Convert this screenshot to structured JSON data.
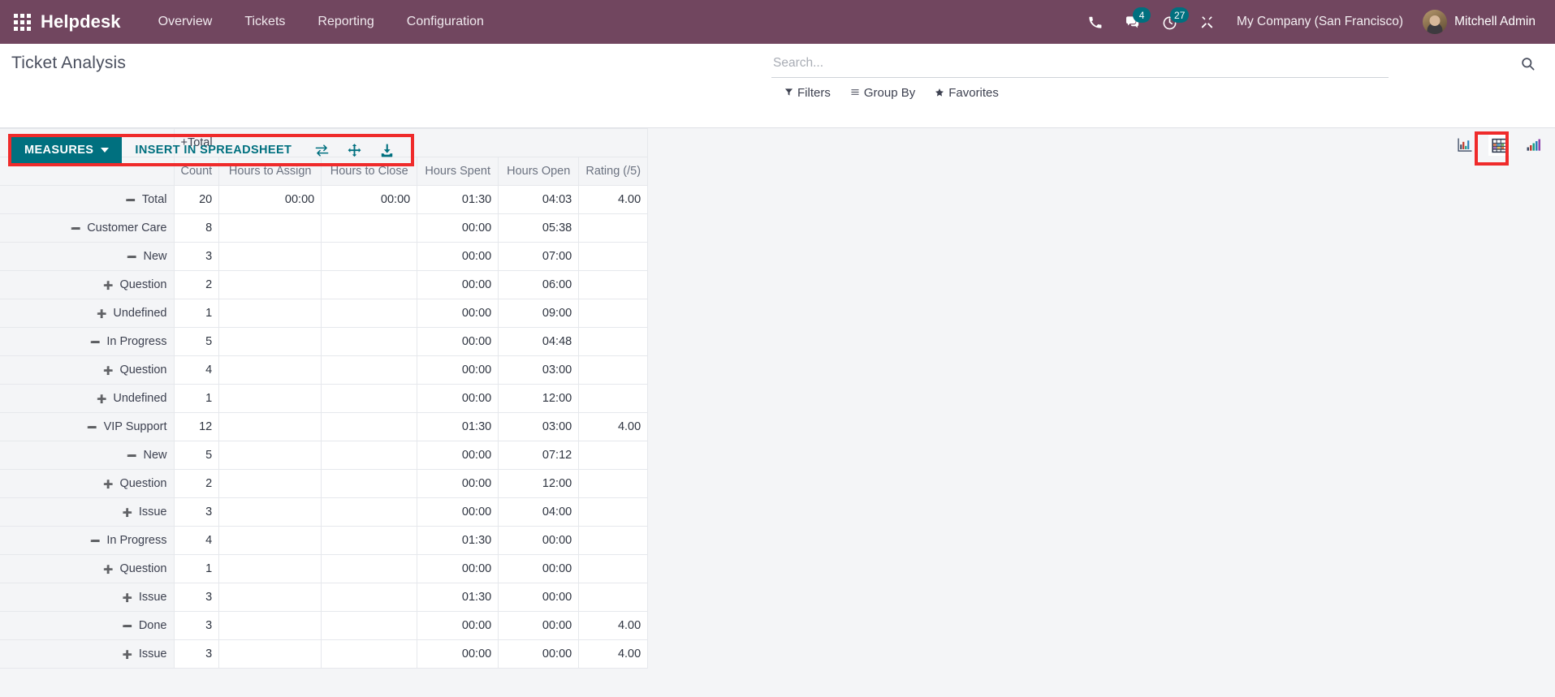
{
  "navbar": {
    "apps_icon": "apps-grid-icon",
    "brand": "Helpdesk",
    "menu": [
      {
        "label": "Overview"
      },
      {
        "label": "Tickets"
      },
      {
        "label": "Reporting"
      },
      {
        "label": "Configuration"
      }
    ],
    "icons": {
      "phone": "phone-icon",
      "messages": "chat-icon",
      "activities": "clock-icon",
      "debug": "wrench-icon"
    },
    "messages_count": "4",
    "activities_count": "27",
    "company": "My Company (San Francisco)",
    "user": "Mitchell Admin",
    "bg_color": "#71465f",
    "badge_color": "#00707f"
  },
  "control_panel": {
    "title": "Ticket Analysis",
    "search": {
      "placeholder": "Search...",
      "value": ""
    },
    "filters": [
      {
        "label": "Filters",
        "icon": "funnel-icon"
      },
      {
        "label": "Group By",
        "icon": "lines-icon"
      },
      {
        "label": "Favorites",
        "icon": "star-icon"
      }
    ],
    "toolbar": {
      "measures_label": "MEASURES",
      "spreadsheet_label": "INSERT IN SPREADSHEET",
      "flip_axis_icon": "flip-axis-icon",
      "expand_all_icon": "expand-all-icon",
      "download_icon": "download-xlsx-icon",
      "accent_color": "#00707f"
    },
    "views": [
      {
        "name": "graph-view",
        "icon": "bar-chart-icon",
        "active": false
      },
      {
        "name": "pivot-view",
        "icon": "pivot-table-icon",
        "active": true
      },
      {
        "name": "chart-view",
        "icon": "ascending-bars-icon",
        "active": false
      }
    ],
    "annotations": [
      {
        "name": "measures-toolbar-highlight",
        "color": "#ef2b2b"
      },
      {
        "name": "pivot-view-highlight",
        "color": "#ef2b2b"
      }
    ]
  },
  "pivot": {
    "corner": "",
    "col_group": {
      "label": "Total",
      "toggle": "+"
    },
    "columns": [
      "Count",
      "Hours to Assign",
      "Hours to Close",
      "Hours Spent",
      "Hours Open",
      "Rating (/5)"
    ],
    "rows": [
      {
        "label": "Total",
        "toggle": "-",
        "indent": 0,
        "values": [
          "20",
          "00:00",
          "00:00",
          "01:30",
          "04:03",
          "4.00"
        ]
      },
      {
        "label": "Customer Care",
        "toggle": "-",
        "indent": 1,
        "values": [
          "8",
          "",
          "",
          "00:00",
          "05:38",
          ""
        ]
      },
      {
        "label": "New",
        "toggle": "-",
        "indent": 2,
        "values": [
          "3",
          "",
          "",
          "00:00",
          "07:00",
          ""
        ]
      },
      {
        "label": "Question",
        "toggle": "+",
        "indent": 3,
        "values": [
          "2",
          "",
          "",
          "00:00",
          "06:00",
          ""
        ]
      },
      {
        "label": "Undefined",
        "toggle": "+",
        "indent": 3,
        "values": [
          "1",
          "",
          "",
          "00:00",
          "09:00",
          ""
        ]
      },
      {
        "label": "In Progress",
        "toggle": "-",
        "indent": 2,
        "values": [
          "5",
          "",
          "",
          "00:00",
          "04:48",
          ""
        ]
      },
      {
        "label": "Question",
        "toggle": "+",
        "indent": 3,
        "values": [
          "4",
          "",
          "",
          "00:00",
          "03:00",
          ""
        ]
      },
      {
        "label": "Undefined",
        "toggle": "+",
        "indent": 3,
        "values": [
          "1",
          "",
          "",
          "00:00",
          "12:00",
          ""
        ]
      },
      {
        "label": "VIP Support",
        "toggle": "-",
        "indent": 1,
        "values": [
          "12",
          "",
          "",
          "01:30",
          "03:00",
          "4.00"
        ]
      },
      {
        "label": "New",
        "toggle": "-",
        "indent": 2,
        "values": [
          "5",
          "",
          "",
          "00:00",
          "07:12",
          ""
        ]
      },
      {
        "label": "Question",
        "toggle": "+",
        "indent": 3,
        "values": [
          "2",
          "",
          "",
          "00:00",
          "12:00",
          ""
        ]
      },
      {
        "label": "Issue",
        "toggle": "+",
        "indent": 3,
        "values": [
          "3",
          "",
          "",
          "00:00",
          "04:00",
          ""
        ]
      },
      {
        "label": "In Progress",
        "toggle": "-",
        "indent": 2,
        "values": [
          "4",
          "",
          "",
          "01:30",
          "00:00",
          ""
        ]
      },
      {
        "label": "Question",
        "toggle": "+",
        "indent": 3,
        "values": [
          "1",
          "",
          "",
          "00:00",
          "00:00",
          ""
        ]
      },
      {
        "label": "Issue",
        "toggle": "+",
        "indent": 3,
        "values": [
          "3",
          "",
          "",
          "01:30",
          "00:00",
          ""
        ]
      },
      {
        "label": "Done",
        "toggle": "-",
        "indent": 2,
        "values": [
          "3",
          "",
          "",
          "00:00",
          "00:00",
          "4.00"
        ]
      },
      {
        "label": "Issue",
        "toggle": "+",
        "indent": 3,
        "values": [
          "3",
          "",
          "",
          "00:00",
          "00:00",
          "4.00"
        ]
      }
    ]
  }
}
